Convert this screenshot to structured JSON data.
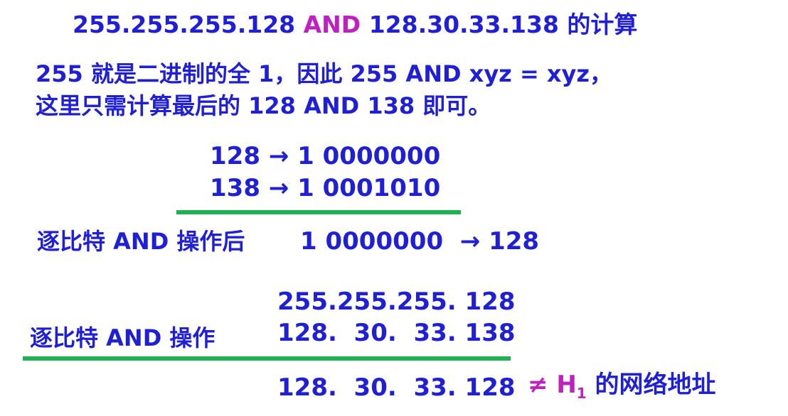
{
  "title": {
    "left": "255.255.255.128 ",
    "op": "AND",
    "right": " 128.30.33.138 的计算"
  },
  "explanation": {
    "line1": "255 就是二进制的全 1，因此 255 AND xyz = xyz，",
    "line2": "这里只需计算最后的 128 AND 138 即可。"
  },
  "binary": {
    "row1": "128 → 1 0000000",
    "row2": "138 → 1 0001010",
    "result_label": "逐比特 AND 操作后",
    "result_value": "1 0000000  → 128"
  },
  "full": {
    "operand1": "255.255.255. 128",
    "operand2": "128.  30.  33. 138",
    "label": "逐比特 AND 操作",
    "result": "128.  30.  33. 128",
    "note_prefix": "≠ H",
    "note_sub": "1",
    "note_suffix": " 的网络地址"
  },
  "colors": {
    "text": "#1f1fd6",
    "highlight": "#c020c0",
    "note": "#c020c0",
    "rule": "#1fb050"
  }
}
